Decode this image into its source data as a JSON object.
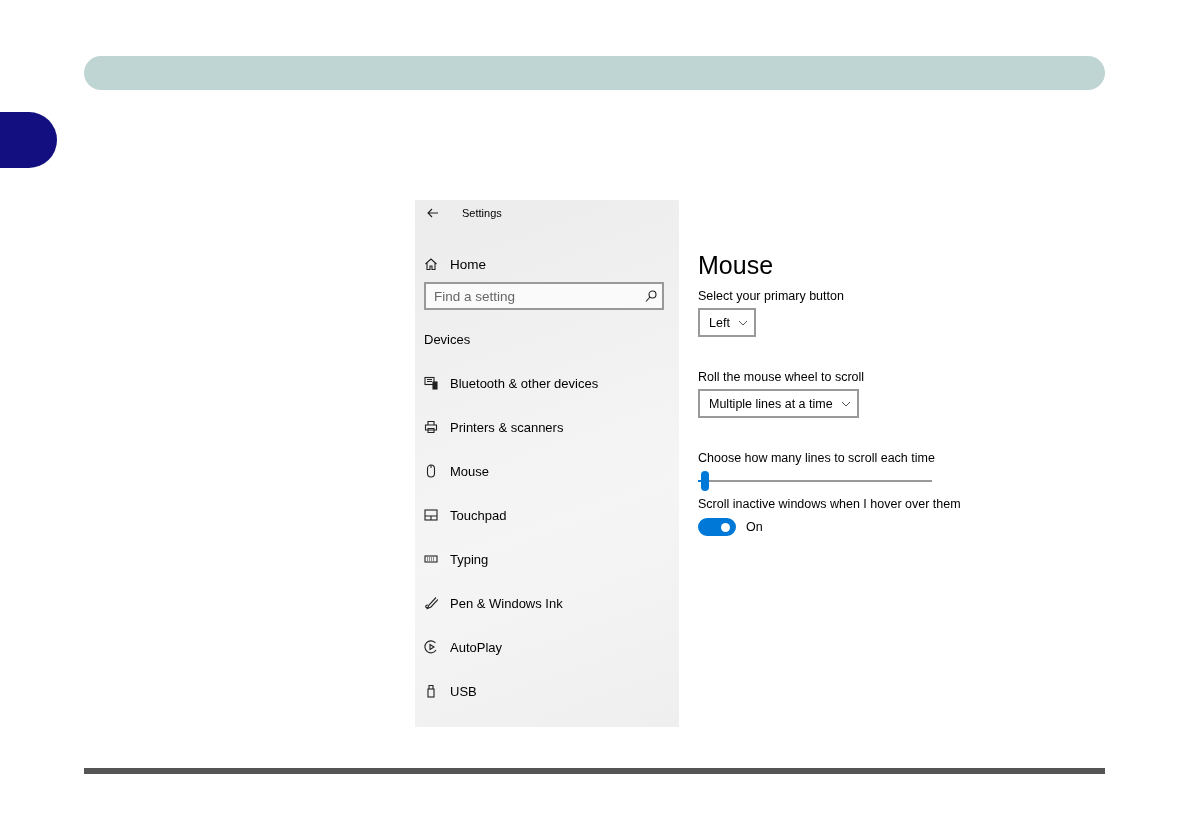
{
  "window": {
    "title": "Settings"
  },
  "sidebar": {
    "home": "Home",
    "search": {
      "placeholder": "Find a setting"
    },
    "section": "Devices",
    "items": [
      {
        "label": "Bluetooth & other devices"
      },
      {
        "label": "Printers & scanners"
      },
      {
        "label": "Mouse"
      },
      {
        "label": "Touchpad"
      },
      {
        "label": "Typing"
      },
      {
        "label": "Pen & Windows Ink"
      },
      {
        "label": "AutoPlay"
      },
      {
        "label": "USB"
      }
    ]
  },
  "content": {
    "title": "Mouse",
    "settings": [
      {
        "kind": "dropdown",
        "label": "Select your primary button",
        "value": "Left"
      },
      {
        "kind": "dropdown",
        "label": "Roll the mouse wheel to scroll",
        "value": "Multiple lines at a time"
      },
      {
        "kind": "slider",
        "label": "Choose how many lines to scroll each time",
        "level": 0.03
      },
      {
        "kind": "toggle",
        "label": "Scroll inactive windows when I hover over them",
        "on": true,
        "state": "On"
      }
    ]
  }
}
